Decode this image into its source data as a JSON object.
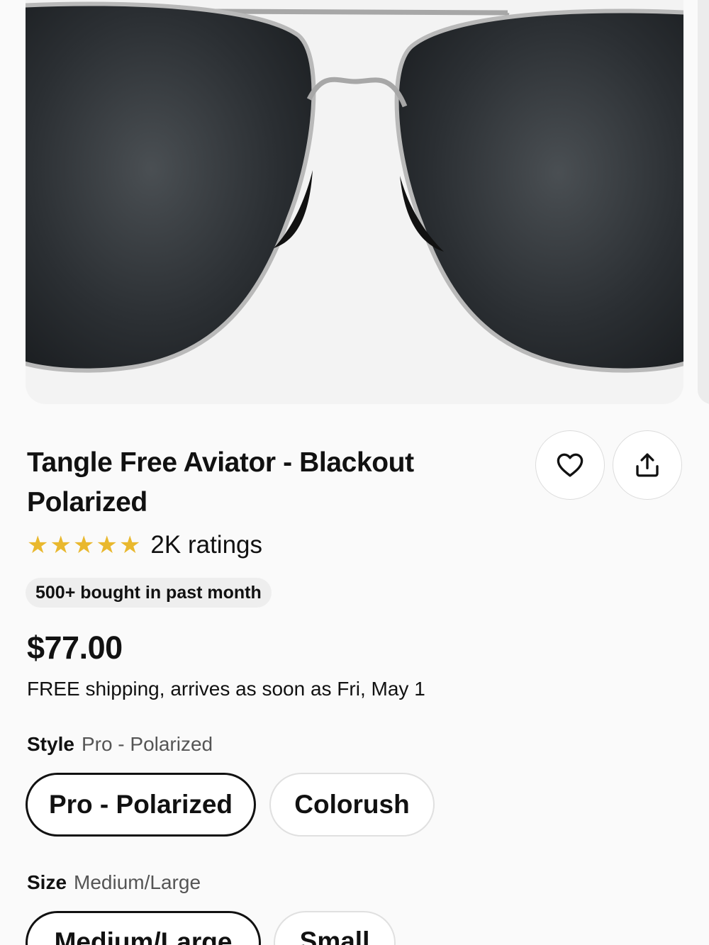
{
  "product": {
    "title": "Tangle Free Aviator - Blackout Polarized",
    "rating_stars": 5,
    "ratings_text": "2K ratings",
    "badge": "500+ bought in past month",
    "price": "$77.00",
    "shipping": "FREE shipping, arrives as soon as Fri, May 1"
  },
  "actions": {
    "favorite_icon": "heart-icon",
    "share_icon": "share-icon"
  },
  "style_option": {
    "label": "Style",
    "selected_value": "Pro - Polarized",
    "choices": [
      "Pro - Polarized",
      "Colorush"
    ]
  },
  "size_option": {
    "label": "Size",
    "selected_value": "Medium/Large",
    "choices": [
      "Medium/Large",
      "Small"
    ]
  },
  "colors": {
    "star": "#e9b82e",
    "badge_bg": "#eeeeee",
    "selected_border": "#111111"
  }
}
